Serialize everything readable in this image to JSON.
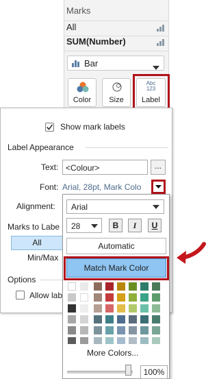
{
  "marks": {
    "title": "Marks",
    "panes": [
      "All",
      "SUM(Number)"
    ],
    "mark_type": "Bar",
    "buttons": [
      {
        "label": "Color",
        "icon": "color-circles-icon"
      },
      {
        "label": "Size",
        "icon": "size-circle-icon"
      },
      {
        "label": "Label",
        "icon": "abc-123-icon",
        "icon_text_top": "Abc",
        "icon_text_bottom": "123"
      }
    ]
  },
  "dialog": {
    "show_labels": "Show mark labels",
    "section_label_appearance": "Label Appearance",
    "text_label": "Text:",
    "text_value": "<Colour>",
    "ellipsis": "...",
    "font_label": "Font:",
    "font_value": "Arial, 28pt, Mark Colo",
    "alignment_label": "Alignment:",
    "marks_to_label": "Marks to Labe",
    "all": "All",
    "min_max": "Min/Max",
    "options": "Options",
    "allow_labels": "Allow lab"
  },
  "font_popup": {
    "font_family": "Arial",
    "font_size": "28",
    "bold": "B",
    "italic": "I",
    "underline": "U",
    "automatic": "Automatic",
    "match_mark_color": "Match Mark Color",
    "more_colors": "More Colors...",
    "opacity": "100%",
    "opacity_value": 1.0
  },
  "colors": {
    "highlight_red": "#b1121a",
    "match_blue": "#8fc5f2",
    "selected_blue": "#cde6fb"
  }
}
